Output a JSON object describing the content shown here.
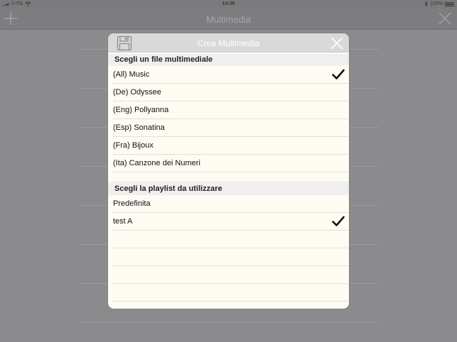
{
  "status_bar": {
    "carrier": "3 ITA",
    "time": "14:38",
    "battery": "100%"
  },
  "nav": {
    "title": "Multimedia"
  },
  "modal": {
    "title": "Crea Multimedia",
    "sections": [
      {
        "header": "Scegli un file multimediale",
        "items": [
          {
            "label": "(All) Music",
            "checked": true
          },
          {
            "label": "(De) Odyssee",
            "checked": false
          },
          {
            "label": "(Eng) Pollyanna",
            "checked": false
          },
          {
            "label": "(Esp) Sonatina",
            "checked": false
          },
          {
            "label": "(Fra) Bijoux",
            "checked": false
          },
          {
            "label": "(Ita) Canzone dei Numeri",
            "checked": false
          }
        ]
      },
      {
        "header": "Scegli la playlist da utilizzare",
        "items": [
          {
            "label": "Predefinita",
            "checked": false
          },
          {
            "label": "test A",
            "checked": true
          }
        ]
      }
    ]
  }
}
